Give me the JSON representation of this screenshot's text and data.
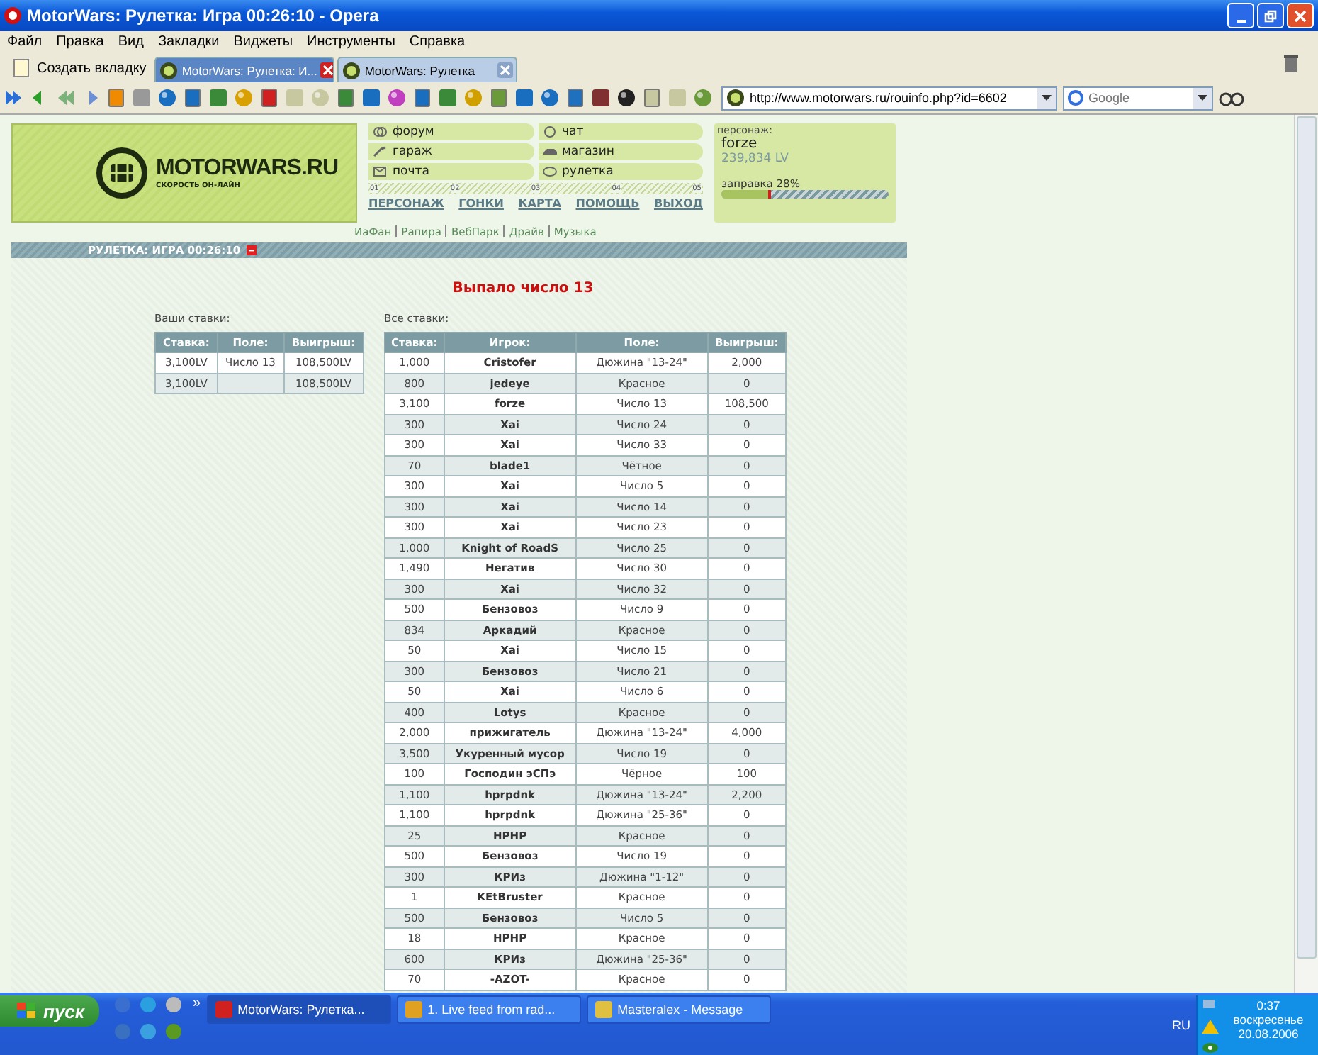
{
  "window": {
    "title": "MotorWars: Рулетка: Игра 00:26:10 - Opera"
  },
  "menu": [
    "Файл",
    "Правка",
    "Вид",
    "Закладки",
    "Виджеты",
    "Инструменты",
    "Справка"
  ],
  "new_tab": "Создать вкладку",
  "tabs": [
    {
      "label": "MotorWars: Рулетка: И...",
      "selected": true
    },
    {
      "label": "MotorWars: Рулетка",
      "selected": false
    }
  ],
  "address": {
    "value": "http://www.motorwars.ru/rouinfo.php?id=6602"
  },
  "search": {
    "placeholder": "Google"
  },
  "site": {
    "logo": "MOTORWARS.RU",
    "slogan": "СКОРОСТЬ ОН-ЛАЙН",
    "links": [
      "форум",
      "чат",
      "гараж",
      "магазин",
      "почта",
      "рулетка"
    ],
    "ruler": [
      "01",
      "02",
      "03",
      "04",
      "05"
    ],
    "nav": [
      "ПЕРСОНАЖ",
      "ГОНКИ",
      "КАРТА",
      "ПОМОЩЬ",
      "ВЫХОД"
    ],
    "partners": [
      "ИаФан",
      "Рапира",
      "ВебПарк",
      "Драйв",
      "Музыка"
    ],
    "character": {
      "label": "персонаж:",
      "name": "forze",
      "money": "239,834 LV",
      "fuel_label": "заправка 28%",
      "level": 0.28
    }
  },
  "game": {
    "title": "РУЛЕТКА: ИГРА 00:26:10",
    "result": "Выпало число 13",
    "my_bets": {
      "caption": "Ваши ставки:",
      "columns": [
        "Ставка:",
        "Поле:",
        "Выигрыш:"
      ],
      "rows": [
        [
          "3,100LV",
          "Число 13",
          "108,500LV"
        ],
        [
          "3,100LV",
          "",
          "108,500LV"
        ]
      ]
    },
    "all_bets": {
      "caption": "Все ставки:",
      "columns": [
        "Ставка:",
        "Игрок:",
        "Поле:",
        "Выигрыш:"
      ],
      "rows": [
        [
          "1,000",
          "Cristofer",
          "Дюжина \"13-24\"",
          "2,000"
        ],
        [
          "800",
          "jedeye",
          "Красное",
          "0"
        ],
        [
          "3,100",
          "forze",
          "Число 13",
          "108,500"
        ],
        [
          "300",
          "Xai",
          "Число 24",
          "0"
        ],
        [
          "300",
          "Xai",
          "Число 33",
          "0"
        ],
        [
          "70",
          "blade1",
          "Чётное",
          "0"
        ],
        [
          "300",
          "Xai",
          "Число 5",
          "0"
        ],
        [
          "300",
          "Xai",
          "Число 14",
          "0"
        ],
        [
          "300",
          "Xai",
          "Число 23",
          "0"
        ],
        [
          "1,000",
          "Knight of RoadS",
          "Число 25",
          "0"
        ],
        [
          "1,490",
          "Негатив",
          "Число 30",
          "0"
        ],
        [
          "300",
          "Xai",
          "Число 32",
          "0"
        ],
        [
          "500",
          "Бензовоз",
          "Число 9",
          "0"
        ],
        [
          "834",
          "Аркадий",
          "Красное",
          "0"
        ],
        [
          "50",
          "Xai",
          "Число 15",
          "0"
        ],
        [
          "300",
          "Бензовоз",
          "Число 21",
          "0"
        ],
        [
          "50",
          "Xai",
          "Число 6",
          "0"
        ],
        [
          "400",
          "Lotys",
          "Красное",
          "0"
        ],
        [
          "2,000",
          "прижигатель",
          "Дюжина \"13-24\"",
          "4,000"
        ],
        [
          "3,500",
          "Укуренный мусор",
          "Число 19",
          "0"
        ],
        [
          "100",
          "Господин эСПэ",
          "Чёрное",
          "100"
        ],
        [
          "1,100",
          "hprpdnk",
          "Дюжина \"13-24\"",
          "2,200"
        ],
        [
          "1,100",
          "hprpdnk",
          "Дюжина \"25-36\"",
          "0"
        ],
        [
          "25",
          "HPHP",
          "Красное",
          "0"
        ],
        [
          "500",
          "Бензовоз",
          "Число 19",
          "0"
        ],
        [
          "300",
          "КРИз",
          "Дюжина \"1-12\"",
          "0"
        ],
        [
          "1",
          "KEtBruster",
          "Красное",
          "0"
        ],
        [
          "500",
          "Бензовоз",
          "Число 5",
          "0"
        ],
        [
          "18",
          "HPHP",
          "Красное",
          "0"
        ],
        [
          "600",
          "КРИз",
          "Дюжина \"25-36\"",
          "0"
        ],
        [
          "70",
          "-AZOT-",
          "Красное",
          "0"
        ]
      ]
    }
  },
  "taskbar": {
    "start": "пуск",
    "more": "»",
    "tasks": [
      {
        "label": "MotorWars: Рулетка...",
        "selected": true
      },
      {
        "label": "1.  Live feed from rad...",
        "selected": false
      },
      {
        "label": "Masteralex - Message",
        "selected": false
      }
    ],
    "language": "RU",
    "time": "0:37",
    "day": "воскресенье",
    "date": "20.08.2006"
  }
}
